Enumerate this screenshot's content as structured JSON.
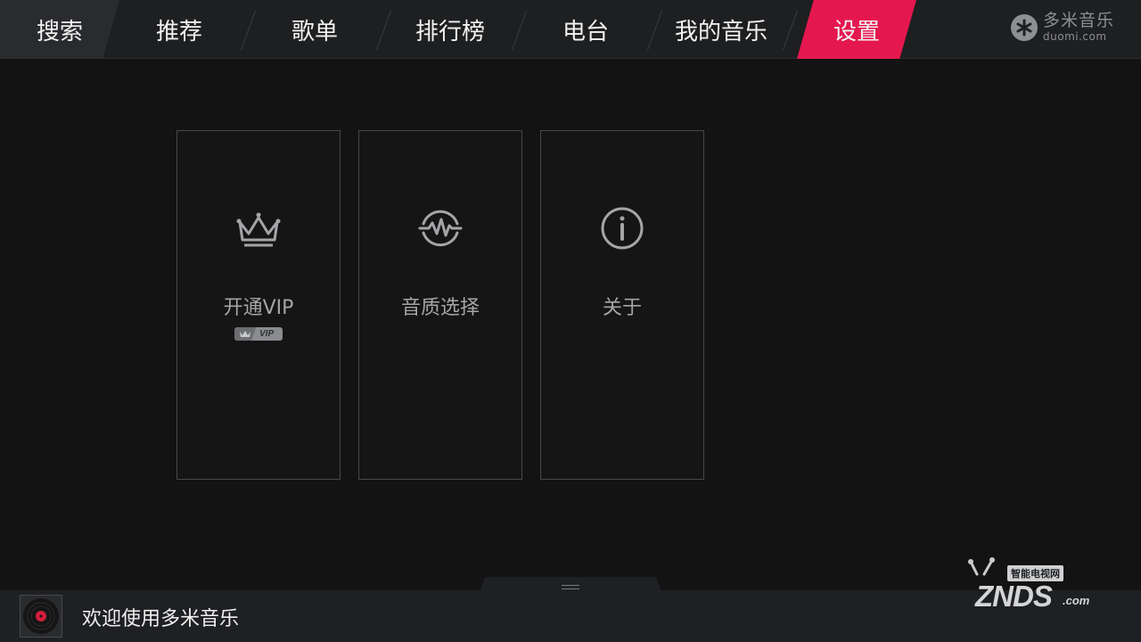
{
  "nav": {
    "tabs": [
      {
        "label": "搜索"
      },
      {
        "label": "推荐"
      },
      {
        "label": "歌单"
      },
      {
        "label": "排行榜"
      },
      {
        "label": "电台"
      },
      {
        "label": "我的音乐"
      },
      {
        "label": "设置"
      }
    ],
    "active_tab": "设置",
    "active_color": "#e5174f"
  },
  "brand": {
    "name": "多米音乐",
    "domain": "duomi.com",
    "icon": "asterisk-logo-icon"
  },
  "settings": {
    "cards": [
      {
        "label": "开通VIP",
        "icon": "crown-icon",
        "badge": "VIP"
      },
      {
        "label": "音质选择",
        "icon": "waveform-icon"
      },
      {
        "label": "关于",
        "icon": "info-icon"
      }
    ]
  },
  "player": {
    "status_text": "欢迎使用多米音乐",
    "album_icon": "vinyl-record-icon"
  },
  "watermark": {
    "cn": "智能电视网",
    "en": "ZNDS",
    "domain": ".com"
  }
}
